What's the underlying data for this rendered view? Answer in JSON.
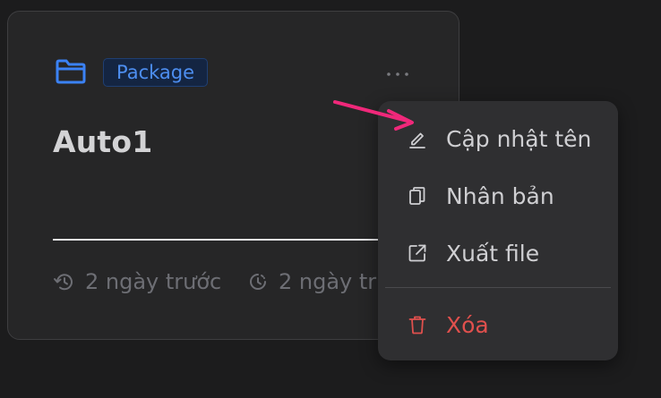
{
  "card": {
    "tag": "Package",
    "title": "Auto1",
    "created": "2 ngày trước",
    "updated": "2 ngày trước"
  },
  "menu": {
    "items": [
      {
        "label": "Cập nhật tên",
        "icon": "pencil-icon"
      },
      {
        "label": "Nhân bản",
        "icon": "copy-icon"
      },
      {
        "label": "Xuất file",
        "icon": "external-link-icon"
      },
      {
        "label": "Xóa",
        "icon": "trash-icon"
      }
    ]
  },
  "colors": {
    "accent": "#3b82f6",
    "danger": "#e0504d",
    "annotation_arrow": "#f0287a"
  }
}
